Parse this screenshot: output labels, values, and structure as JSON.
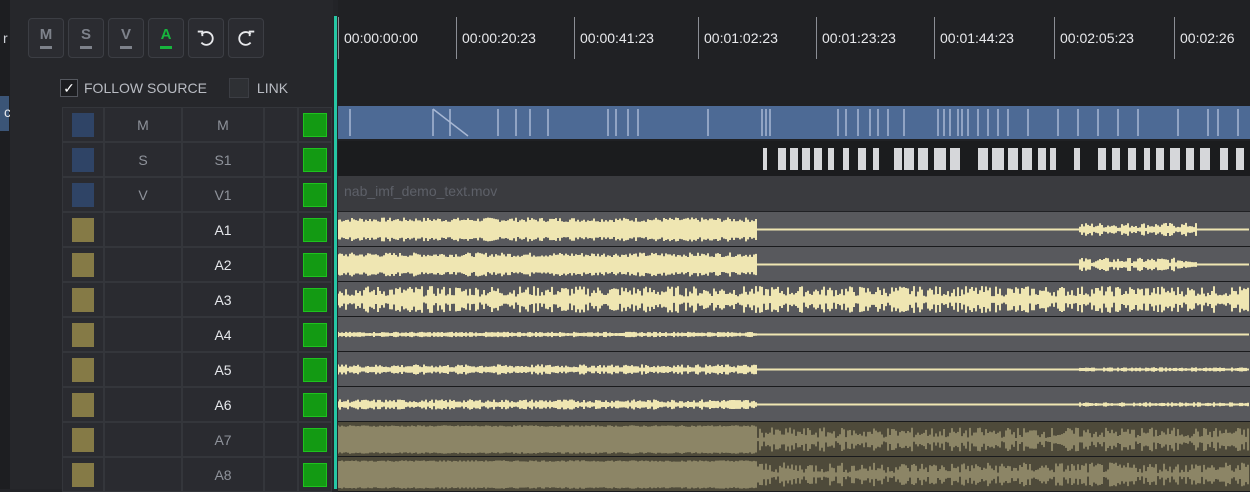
{
  "toolbar": {
    "buttons": [
      {
        "label": "M",
        "active": false
      },
      {
        "label": "S",
        "active": false
      },
      {
        "label": "V",
        "active": false
      },
      {
        "label": "A",
        "active": true
      }
    ],
    "undo_icon": "undo-icon",
    "redo_icon": "redo-icon",
    "active_color": "#17b53d"
  },
  "options": {
    "follow_source_label": "FOLLOW SOURCE",
    "follow_source_checked": true,
    "link_label": "LINK",
    "link_checked": false
  },
  "edge": {
    "glyph_top": "r",
    "glyph_selected": "c"
  },
  "tracks": [
    {
      "src": "M",
      "dst": "M",
      "kind": "M",
      "swatch": "#2f4466",
      "dim": true
    },
    {
      "src": "S",
      "dst": "S1",
      "kind": "S",
      "swatch": "#2f4466",
      "dim": true
    },
    {
      "src": "V",
      "dst": "V1",
      "kind": "V",
      "swatch": "#2f4466",
      "dim": true
    },
    {
      "src": "",
      "dst": "A1",
      "kind": "A",
      "swatch": "#857a46",
      "dim": false
    },
    {
      "src": "",
      "dst": "A2",
      "kind": "A",
      "swatch": "#857a46",
      "dim": false
    },
    {
      "src": "",
      "dst": "A3",
      "kind": "A",
      "swatch": "#857a46",
      "dim": false
    },
    {
      "src": "",
      "dst": "A4",
      "kind": "A",
      "swatch": "#857a46",
      "dim": false
    },
    {
      "src": "",
      "dst": "A5",
      "kind": "A",
      "swatch": "#857a46",
      "dim": false
    },
    {
      "src": "",
      "dst": "A6",
      "kind": "A",
      "swatch": "#857a46",
      "dim": false
    },
    {
      "src": "",
      "dst": "A7",
      "kind": "A",
      "swatch": "#857a46",
      "dim": true
    },
    {
      "src": "",
      "dst": "A8",
      "kind": "A",
      "swatch": "#857a46",
      "dim": true
    }
  ],
  "timeline": {
    "timecodes": [
      "00:00:00:00",
      "00:00:20:23",
      "00:00:41:23",
      "00:01:02:23",
      "00:01:23:23",
      "00:01:44:23",
      "00:02:05:23",
      "00:02:26"
    ],
    "video_clip_name": "nab_imf_demo_text.mov",
    "colors": {
      "marker_lane": "#4d6a95",
      "audio_active": "#efe6b2",
      "audio_dim": "#8c8566",
      "playhead": "#26c6a4"
    }
  }
}
